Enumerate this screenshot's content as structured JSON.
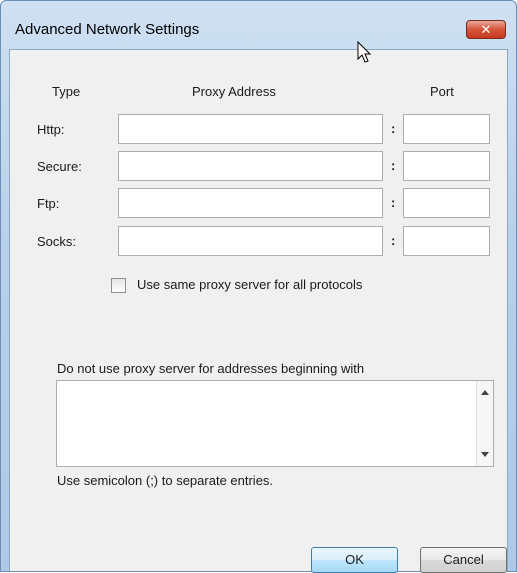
{
  "window": {
    "title": "Advanced Network Settings",
    "close_glyph": "✕"
  },
  "columns": {
    "type": "Type",
    "proxy": "Proxy Address",
    "port": "Port"
  },
  "rows": [
    {
      "label": "Http:",
      "address": "",
      "port": ""
    },
    {
      "label": "Secure:",
      "address": "",
      "port": ""
    },
    {
      "label": "Ftp:",
      "address": "",
      "port": ""
    },
    {
      "label": "Socks:",
      "address": "",
      "port": ""
    }
  ],
  "separator": ":",
  "same_proxy": {
    "label": "Use same proxy server for all protocols",
    "checked": false
  },
  "exclusions": {
    "label": "Do not use proxy server for addresses beginning with",
    "value": "",
    "hint": "Use semicolon (;) to separate entries."
  },
  "buttons": {
    "ok": "OK",
    "cancel": "Cancel"
  },
  "colors": {
    "title_bar": "#b9d1ea",
    "close_button": "#d5553b",
    "client": "#f0f0f0"
  },
  "icons": {
    "cursor": "mouse-pointer-icon",
    "close": "close-icon"
  }
}
